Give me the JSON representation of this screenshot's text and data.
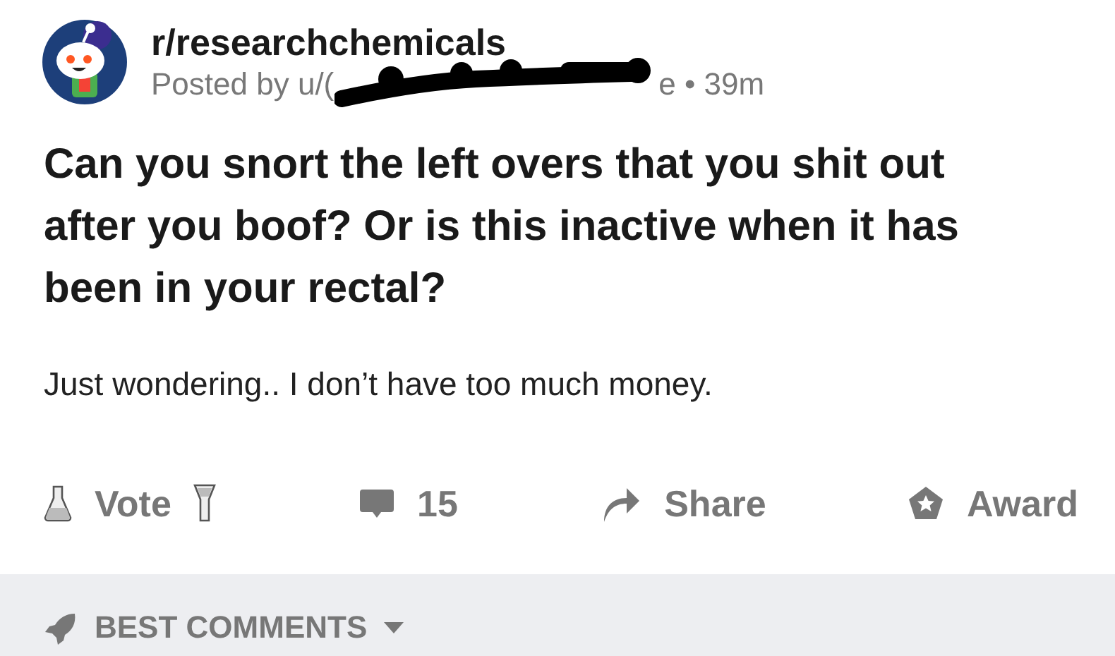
{
  "post": {
    "subreddit": "r/researchchemicals",
    "meta_prefix": "Posted by u/(",
    "meta_suffix": "e • 39m",
    "title": "Can you snort the left overs that you shit out after you boof? Or is this inactive when it has been in your rectal?",
    "body": "Just wondering.. I don’t have too much money."
  },
  "actions": [
    {
      "kind": "vote",
      "label": "Vote"
    },
    {
      "kind": "comments",
      "label": "15"
    },
    {
      "kind": "share",
      "label": "Share"
    },
    {
      "kind": "award",
      "label": "Award"
    }
  ],
  "sort": {
    "label": "BEST COMMENTS"
  }
}
